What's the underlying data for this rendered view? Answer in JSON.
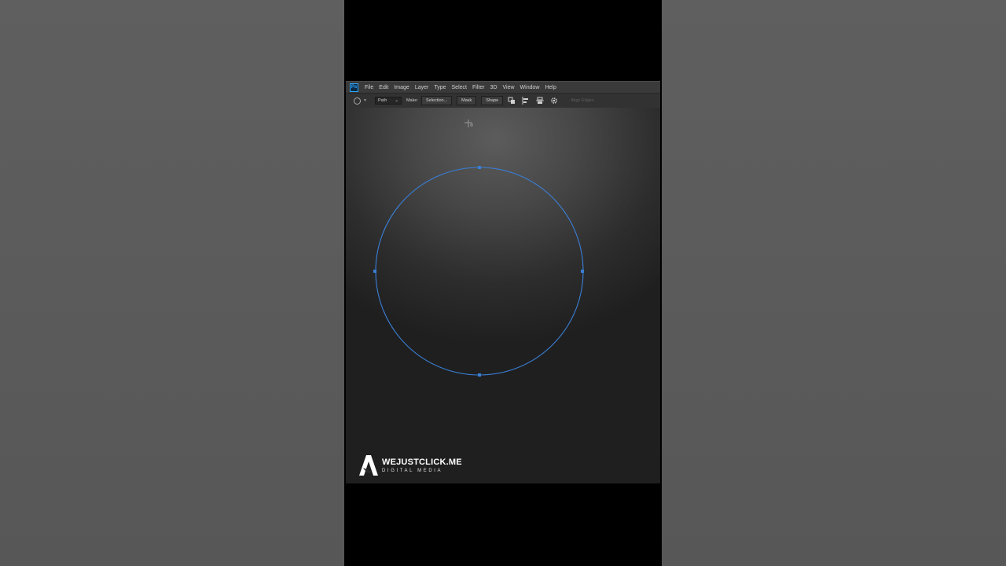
{
  "menu": {
    "items": [
      "File",
      "Edit",
      "Image",
      "Layer",
      "Type",
      "Select",
      "Filter",
      "3D",
      "View",
      "Window",
      "Help"
    ]
  },
  "options": {
    "mode_value": "Path",
    "make_label": "Make:",
    "selection_button": "Selection...",
    "mask_button": "Mask",
    "shape_button": "Shape",
    "align_edges_label": "Align Edges"
  },
  "brand": {
    "name": "WEJUSTCLICK.ME",
    "subtitle": "DIGITAL MEDIA"
  },
  "icons": [
    "ps-logo-icon",
    "ellipse-tool-icon",
    "path-operations-icon",
    "path-alignment-icon",
    "path-arrangement-icon",
    "gear-icon",
    "crosshair-cursor-icon",
    "brand-logo-icon"
  ],
  "colors": {
    "path_color": "#3a7fd6",
    "ps_accent": "#31a8ff"
  }
}
